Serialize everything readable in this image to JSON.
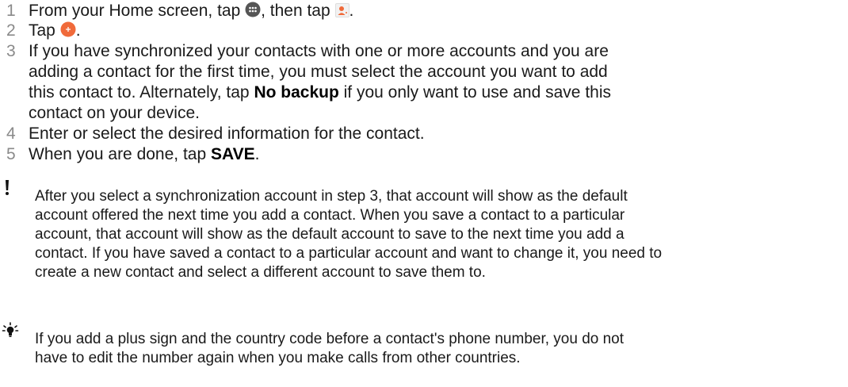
{
  "steps": [
    {
      "num": "1",
      "parts": {
        "a": "From your Home screen, tap ",
        "icon1": "apps-grid-icon",
        "b": ", then tap ",
        "icon2": "contacts-app-icon",
        "c": "."
      }
    },
    {
      "num": "2",
      "parts": {
        "a": "Tap ",
        "icon1": "add-contact-fab-icon",
        "b": "."
      }
    },
    {
      "num": "3",
      "lines": [
        "If you have synchronized your contacts with one or more accounts and you are",
        "adding a contact for the first time, you must select the account you want to add"
      ],
      "line3": {
        "a": "this contact to. Alternately, tap ",
        "bold": "No backup",
        "b": " if you only want to use and save this"
      },
      "line4": "contact on your device."
    },
    {
      "num": "4",
      "text": "Enter or select the desired information for the contact."
    },
    {
      "num": "5",
      "a": "When you are done, tap ",
      "bold": "SAVE",
      "b": "."
    }
  ],
  "note": {
    "icon": "exclamation-icon",
    "lines": [
      "After you select a synchronization account in step 3, that account will show as the default",
      "account offered the next time you add a contact. When you save a contact to a particular",
      "account, that account will show as the default account to save to the next time you add a",
      "contact. If you have saved a contact to a particular account and want to change it, you need to",
      "create a new contact and select a different account to save them to."
    ]
  },
  "tip": {
    "icon": "lightbulb-icon",
    "lines": [
      "If you add a plus sign and the country code before a contact's phone number, you do not",
      "have to edit the number again when you make calls from other countries."
    ]
  },
  "colors": {
    "accent": "#f06a3a",
    "icon_dark": "#555555",
    "number_gray": "#8a8a8a"
  }
}
